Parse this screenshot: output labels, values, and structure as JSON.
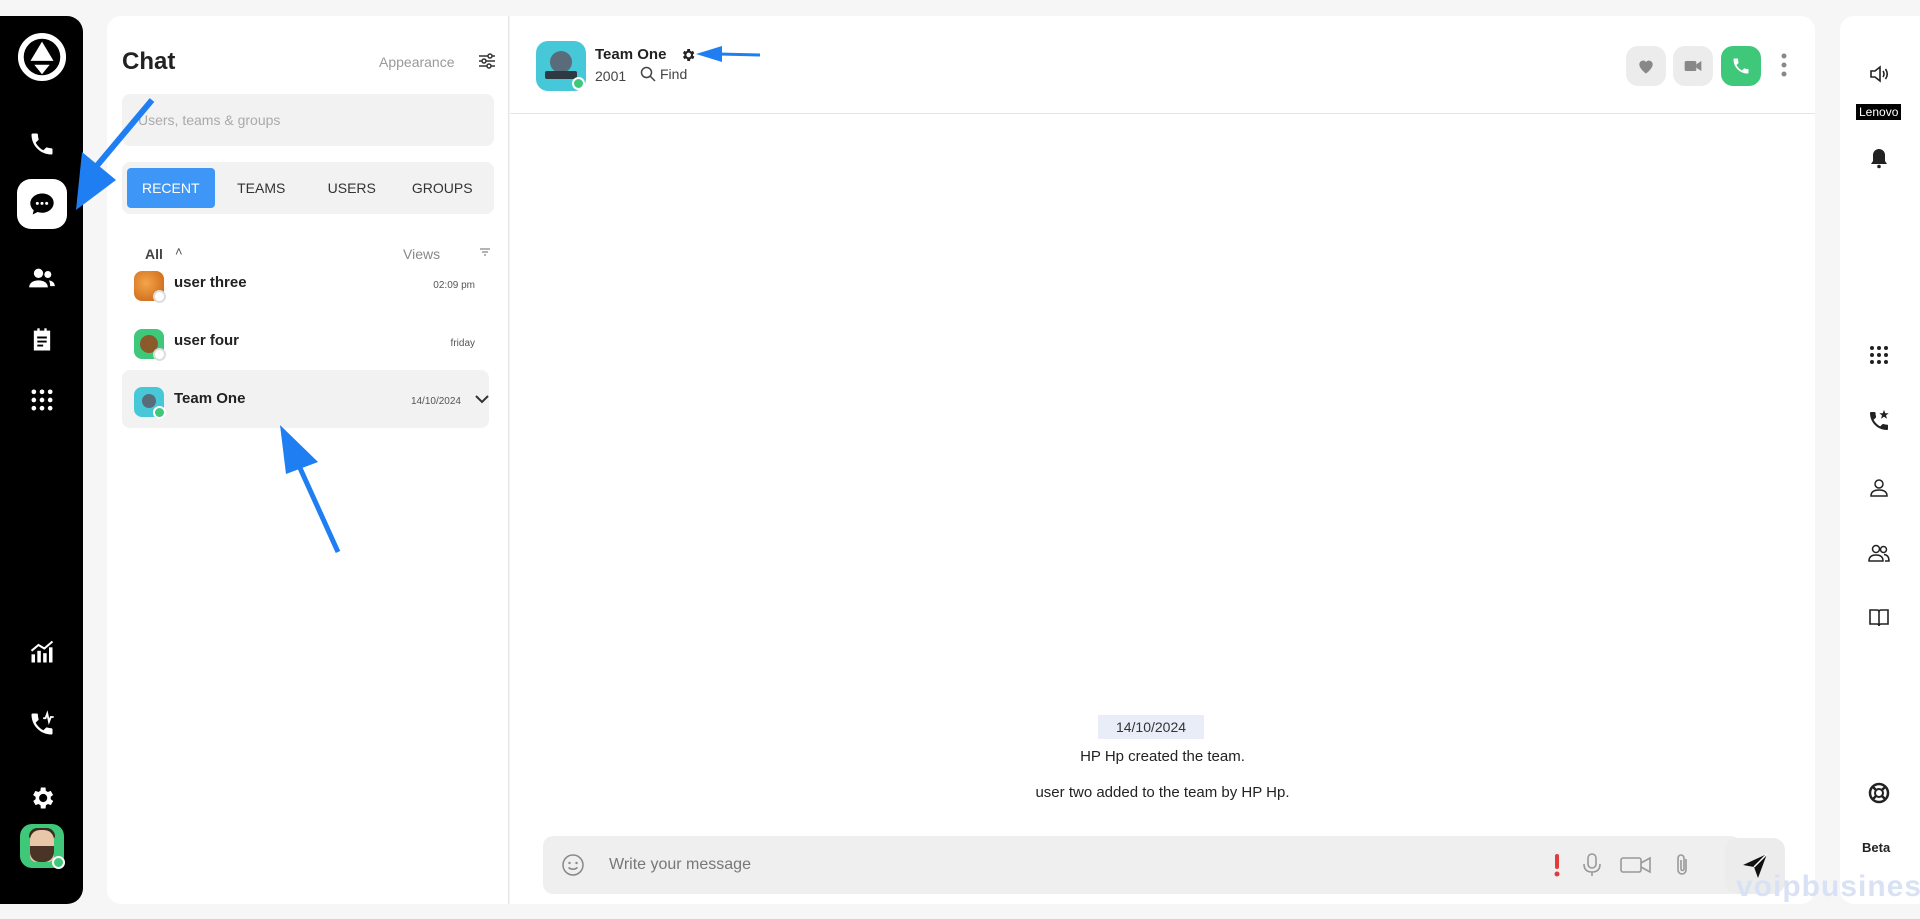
{
  "left_rail": {
    "items": [
      "phone-icon",
      "chat-icon",
      "users-icon",
      "notes-icon",
      "dialpad-icon",
      "analytics-icon",
      "call-activity-icon",
      "settings-icon"
    ],
    "active": "chat-icon"
  },
  "chat_list": {
    "title": "Chat",
    "appearance_label": "Appearance",
    "search_placeholder": "Users, teams & groups",
    "tabs": [
      "RECENT",
      "TEAMS",
      "USERS",
      "GROUPS"
    ],
    "active_tab": "RECENT",
    "filter_all": "All",
    "filter_views": "Views",
    "conversations": [
      {
        "name": "user three",
        "time": "02:09 pm"
      },
      {
        "name": "user four",
        "time": "friday"
      },
      {
        "name": "Team One",
        "time": "14/10/2024"
      }
    ]
  },
  "chat": {
    "team_name": "Team One",
    "extension": "2001",
    "find_label": "Find",
    "date_chip": "14/10/2024",
    "messages": [
      "HP Hp created the team.",
      "user two added to the team by HP Hp."
    ],
    "composer_placeholder": "Write your message"
  },
  "right_rail": {
    "device_label": "Lenovo",
    "beta_label": "Beta"
  },
  "watermark": "voipbusiness",
  "colors": {
    "accent": "#3e96f6",
    "call_green": "#3fc87a",
    "arrow_blue": "#1e7ef2",
    "rail_black": "#000000"
  }
}
